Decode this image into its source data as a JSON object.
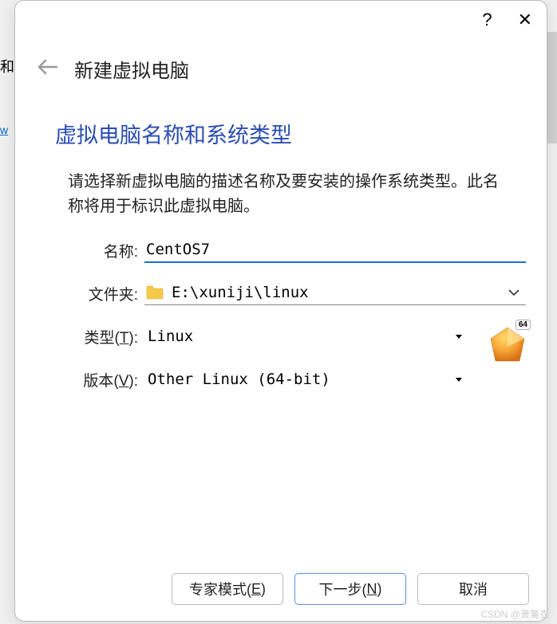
{
  "bg": {
    "fragment_left": "和",
    "fragment_link": "w"
  },
  "titlebar": {
    "help": "?",
    "close": "✕"
  },
  "header": {
    "title": "新建虚拟电脑"
  },
  "section": {
    "title": "虚拟电脑名称和系统类型",
    "description": "请选择新虚拟电脑的描述名称及要安装的操作系统类型。此名称将用于标识此虚拟电脑。"
  },
  "form": {
    "name_label": "名称:",
    "name_value": "CentOS7",
    "folder_label": "文件夹:",
    "folder_value": "E:\\xuniji\\linux",
    "type_label_prefix": "类型(",
    "type_label_key": "T",
    "type_label_suffix": "):",
    "type_value": "Linux",
    "version_label_prefix": "版本(",
    "version_label_key": "V",
    "version_label_suffix": "):",
    "version_value": "Other Linux (64-bit)",
    "os_badge": "64"
  },
  "buttons": {
    "expert_prefix": "专家模式(",
    "expert_key": "E",
    "expert_suffix": ")",
    "next_prefix": "下一步(",
    "next_key": "N",
    "next_suffix": ")",
    "cancel": "取消"
  },
  "watermark": "CSDN @萧篱衣"
}
